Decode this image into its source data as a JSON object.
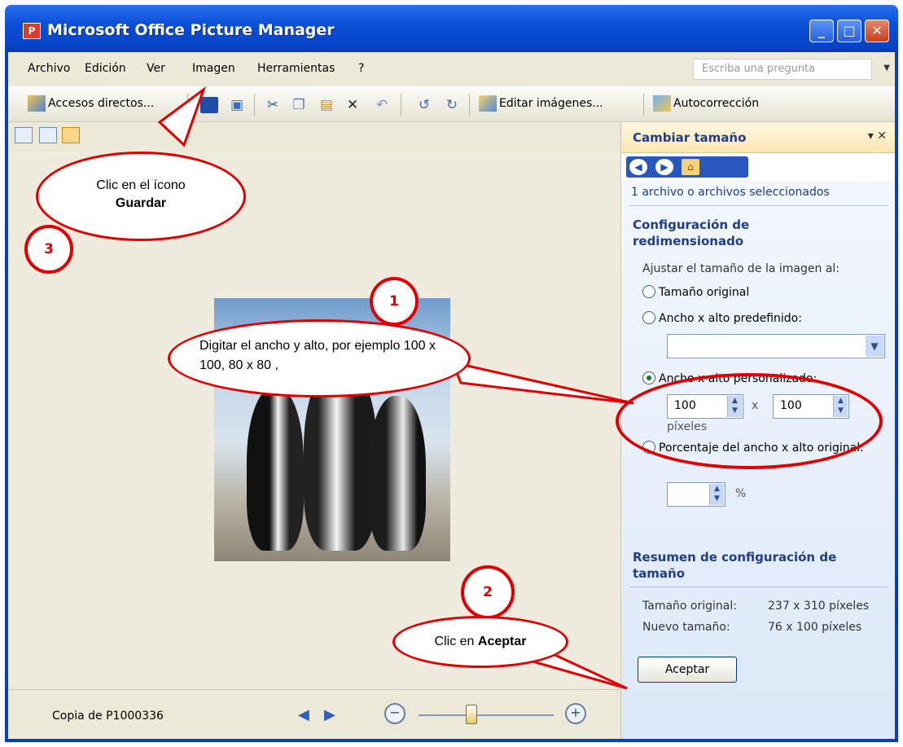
{
  "window": {
    "title": "Microsoft Office Picture Manager",
    "app_icon": "picture-manager-icon"
  },
  "menubar": {
    "items": [
      "Archivo",
      "Edición",
      "Ver",
      "Imagen",
      "Herramientas",
      "?"
    ],
    "ask_placeholder": "Escriba una pregunta"
  },
  "toolbar": {
    "shortcuts_label": "Accesos directos...",
    "edit_label": "Editar imágenes...",
    "autocorrect_label": "Autocorrección"
  },
  "statusbar": {
    "filename": "Copia de P1000336",
    "zoom_level": 0.38
  },
  "pane": {
    "title": "Cambiar tamaño",
    "selected_count": "1 archivo o archivos seleccionados",
    "settings_heading": "Configuración de redimensionado",
    "adjust_label": "Ajustar el tamaño de la imagen al:",
    "opt_original": "Tamaño original",
    "opt_predefined": "Ancho x alto predefinido:",
    "opt_custom": "Ancho x alto personalizado:",
    "width_value": "100",
    "times": "x",
    "height_value": "100",
    "pixels_unit": "píxeles",
    "opt_percent": "Porcentaje del ancho x alto original:",
    "percent_value": "",
    "percent_sign": "%",
    "summary_heading": "Resumen de configuración de tamaño",
    "original_size_label": "Tamaño original:",
    "original_size_value": "237 x 310 píxeles",
    "new_size_label": "Nuevo tamaño:",
    "new_size_value": "76 x 100 píxeles",
    "accept_label": "Aceptar"
  },
  "annotations": {
    "step1_number": "1",
    "step1_text": "Digitar el ancho y alto, por ejemplo 100 x 100,  80 x 80 ,",
    "step2_number": "2",
    "step2_text_prefix": "Clic en ",
    "step2_text_bold": "Aceptar",
    "step3_number": "3",
    "step3_text": "Clic en el ícono",
    "step3_text_bold": "Guardar",
    "accent_color": "#e00000"
  }
}
